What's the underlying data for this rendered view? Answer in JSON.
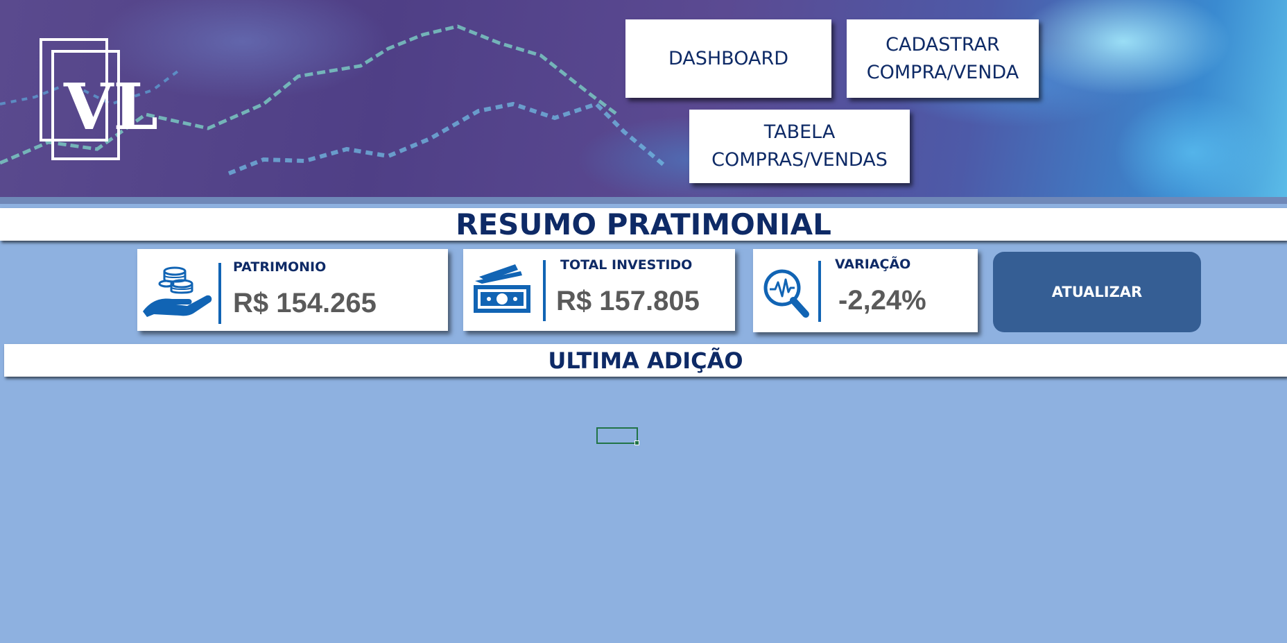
{
  "nav": {
    "dashboard": "DASHBOARD",
    "cadastrar": [
      "CADASTRAR",
      "COMPRA/VENDA"
    ],
    "tabela": [
      "TABELA",
      "COMPRAS/VENDAS"
    ]
  },
  "logo": {
    "text": "VL"
  },
  "sections": {
    "resumo": "RESUMO PRATIMONIAL",
    "ultima": "ULTIMA ADIÇÃO"
  },
  "cards": [
    {
      "label": "PATRIMONIO",
      "value": "R$ 154.265",
      "icon": "coins-hand-icon"
    },
    {
      "label": "TOTAL INVESTIDO",
      "value": "R$ 157.805",
      "icon": "money-bills-icon"
    },
    {
      "label": "VARIAÇÃO",
      "value": "-2,24%",
      "icon": "magnifier-pulse-icon"
    }
  ],
  "actions": {
    "update": "ATUALIZAR"
  },
  "colors": {
    "background": "#8eb1e0",
    "navy_text": "#0e2a66",
    "accent_blue": "#1164b4",
    "update_button": "#355e94",
    "selection": "#217346"
  }
}
